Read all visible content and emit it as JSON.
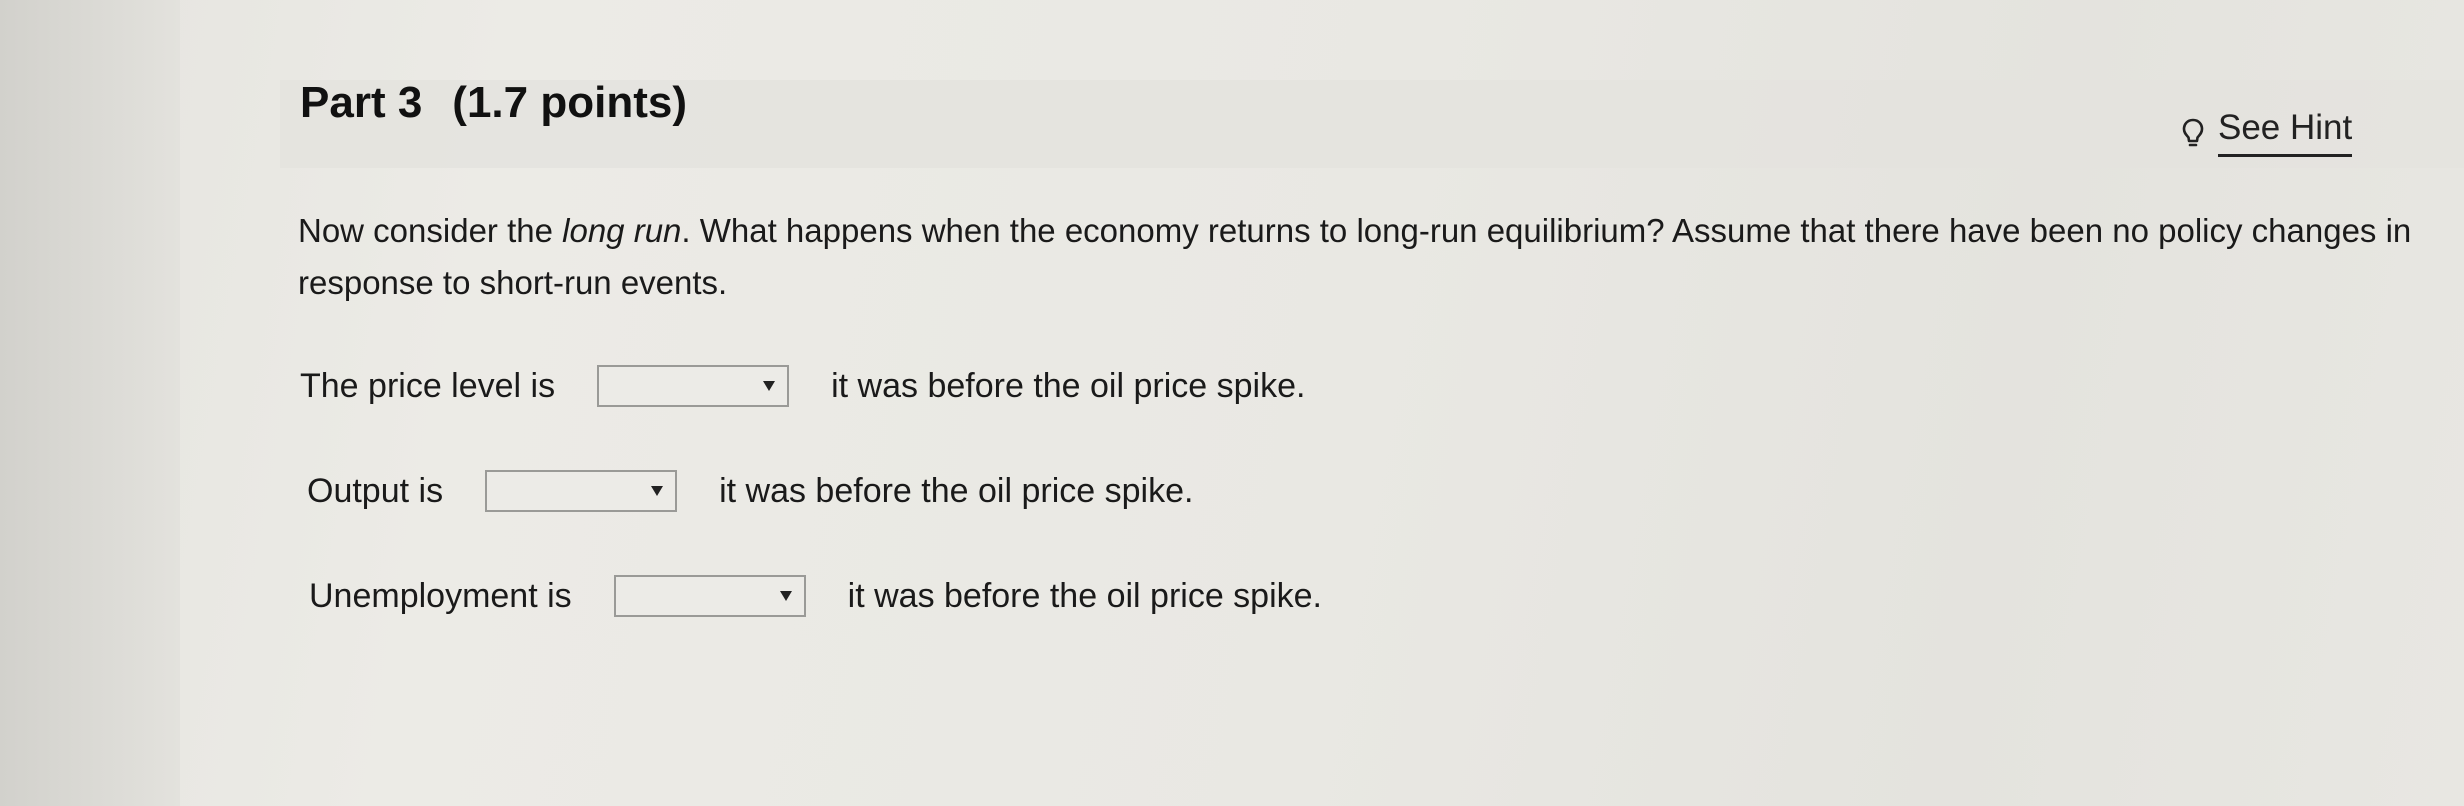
{
  "part": {
    "title": "Part 3",
    "points": "(1.7 points)"
  },
  "hint": {
    "icon": "lightbulb-icon",
    "label": "See Hint"
  },
  "question": {
    "text_before": "Now consider the ",
    "emphasis": "long run",
    "text_after": ". What happens when the economy returns to long-run equilibrium? Assume that there have been no policy changes in response to short-run events."
  },
  "rows": [
    {
      "label": "The price level is",
      "selected": "",
      "suffix": "it was before the oil price spike."
    },
    {
      "label": "Output is",
      "selected": "",
      "suffix": "it was before the oil price spike."
    },
    {
      "label": "Unemployment is",
      "selected": "",
      "suffix": "it was before the oil price spike."
    }
  ]
}
